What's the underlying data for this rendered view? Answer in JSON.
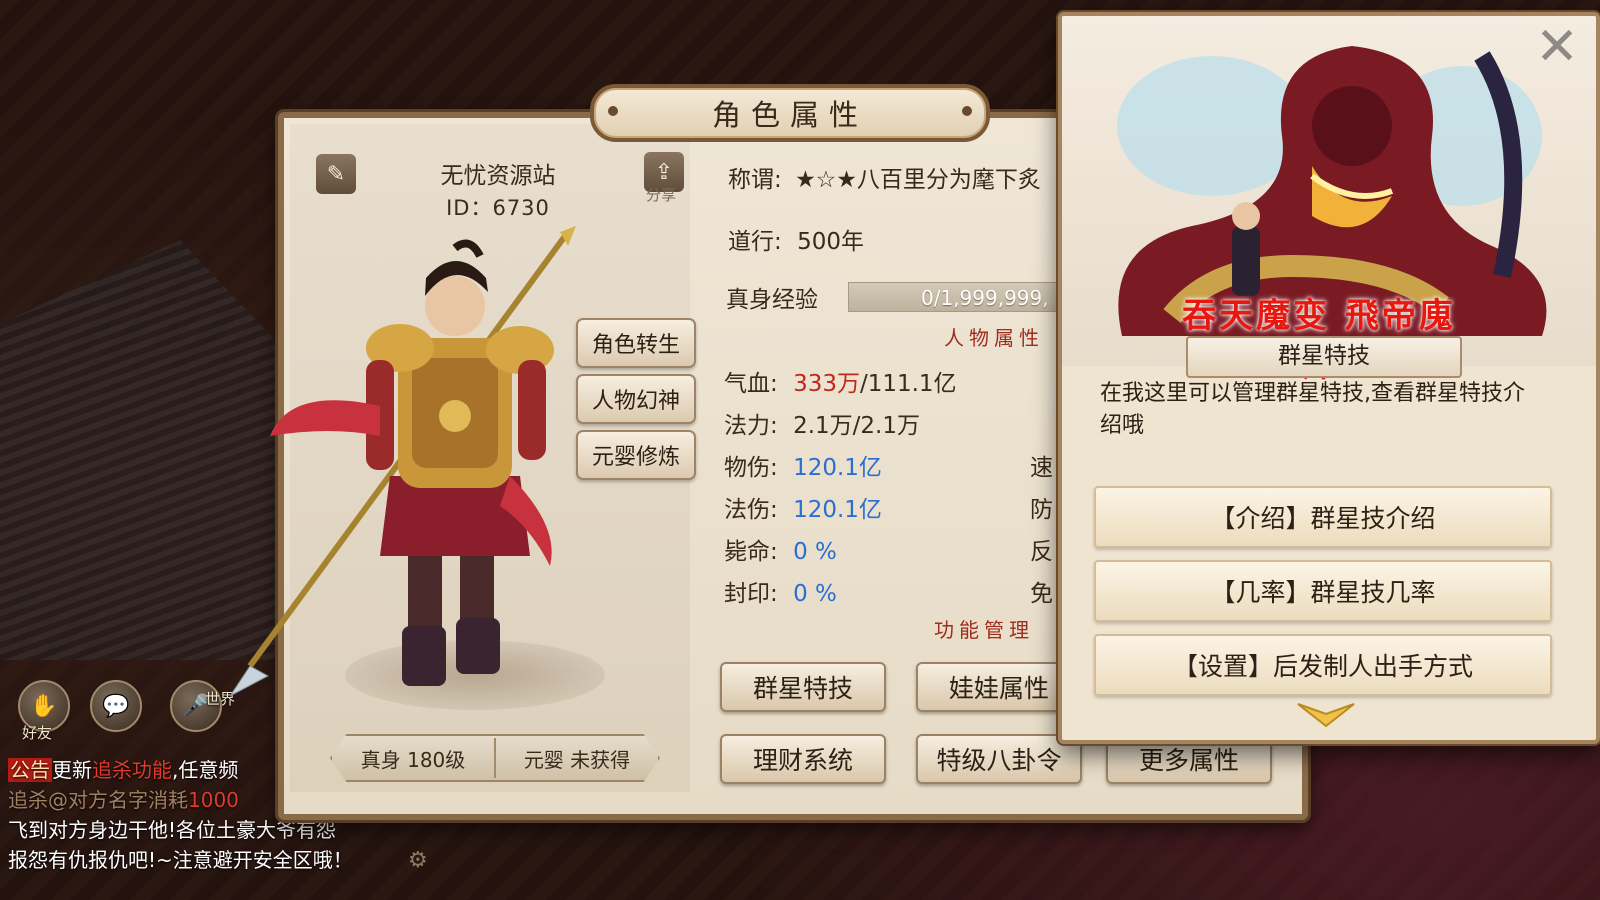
{
  "hud": {
    "friends_label": "好友",
    "world_label": "世界"
  },
  "chat": {
    "tag": "公告",
    "line1_a": "更新",
    "line1_b": "追杀功能",
    "line1_c": ",任意频",
    "line2_a": "追杀@对方名字消耗",
    "line2_b": "1000",
    "line3": "飞到对方身边干他!各位土豪大爷有怨",
    "line4": "报怨有仇报仇吧!~注意避开安全区哦！"
  },
  "panel": {
    "title": "角色属性",
    "character": {
      "name": "无忧资源站",
      "id_text": "ID：6730",
      "share_label": "分享"
    },
    "side_buttons": [
      "角色转生",
      "人物幻神",
      "元婴修炼"
    ],
    "level_bar": {
      "body_level": "真身 180级",
      "yuanying": "元婴 未获得"
    },
    "info": {
      "title_label": "称谓:",
      "title_value": "★☆★八百里分为麾下炙",
      "daoxing_label": "道行:",
      "daoxing_value": "500年",
      "exp_label": "真身经验",
      "exp_value": "0/1,999,999,"
    },
    "attr_section": "人物属性",
    "attributes": {
      "hp_label": "气血:",
      "hp_current": "333万",
      "hp_max": "/111.1亿",
      "mp_label": "法力:",
      "mp_value": "2.1万/2.1万",
      "phys_label": "物伤:",
      "phys_value": "120.1亿",
      "magic_label": "法伤:",
      "magic_value": "120.1亿",
      "crit_label": "毙命:",
      "crit_value": "0 %",
      "seal_label": "封印:",
      "seal_value": "0 %",
      "speed_label": "速",
      "defense_label": "防",
      "counter_label": "反",
      "immune_label": "免"
    },
    "func_section": "功能管理",
    "func_buttons": {
      "star_skill": "群星特技",
      "doll_attr": "娃娃属性",
      "finance": "理财系统",
      "bagua": "特级八卦令",
      "more_attr": "更多属性"
    }
  },
  "popup": {
    "art_caption": "吞天魔变 飛帝廆帅",
    "title": "群星特技",
    "description": "在我这里可以管理群星特技,查看群星特技介绍哦",
    "options": [
      "【介绍】群星技介绍",
      "【几率】群星技几率",
      "【设置】后发制人出手方式"
    ]
  }
}
